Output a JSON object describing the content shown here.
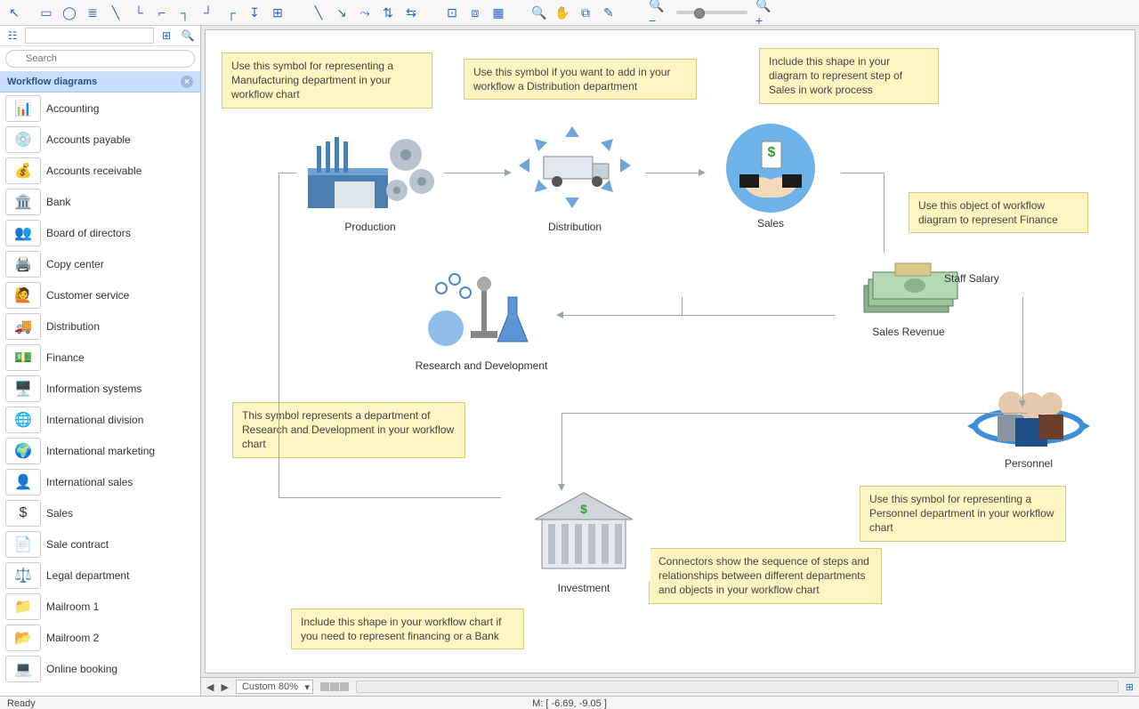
{
  "toolbar_icons": [
    "↖",
    "▭",
    "◯",
    "≣",
    "⤡",
    "↳",
    "⌐",
    "⎍",
    "└",
    "┌",
    "↧",
    "⊞",
    " ",
    "╲",
    "↘",
    "⤳",
    "⇅",
    "⇆",
    " ",
    "⊡",
    "⧈",
    "▦",
    " ",
    "⊕",
    "✋",
    "≡",
    "✎",
    " ",
    "🔍-",
    "",
    "🔍+"
  ],
  "search": {
    "placeholder": "Search"
  },
  "section_title": "Workflow diagrams",
  "stencils": [
    {
      "label": "Accounting",
      "glyph": "📊"
    },
    {
      "label": "Accounts payable",
      "glyph": "💿"
    },
    {
      "label": "Accounts receivable",
      "glyph": "💰"
    },
    {
      "label": "Bank",
      "glyph": "🏛️"
    },
    {
      "label": "Board of directors",
      "glyph": "👥"
    },
    {
      "label": "Copy center",
      "glyph": "🖨️"
    },
    {
      "label": "Customer service",
      "glyph": "🙋"
    },
    {
      "label": "Distribution",
      "glyph": "🚚"
    },
    {
      "label": "Finance",
      "glyph": "💵"
    },
    {
      "label": "Information systems",
      "glyph": "🖥️"
    },
    {
      "label": "International division",
      "glyph": "🌐"
    },
    {
      "label": "International marketing",
      "glyph": "🌍"
    },
    {
      "label": "International sales",
      "glyph": "👤"
    },
    {
      "label": "Sales",
      "glyph": "$"
    },
    {
      "label": "Sale contract",
      "glyph": "📄"
    },
    {
      "label": "Legal department",
      "glyph": "⚖️"
    },
    {
      "label": "Mailroom 1",
      "glyph": "📁"
    },
    {
      "label": "Mailroom 2",
      "glyph": "📂"
    },
    {
      "label": "Online booking",
      "glyph": "💻"
    }
  ],
  "nodes": {
    "production": {
      "label": "Production"
    },
    "distribution": {
      "label": "Distribution"
    },
    "sales": {
      "label": "Sales"
    },
    "research": {
      "label": "Research and Development"
    },
    "sales_revenue": {
      "label": "Sales Revenue"
    },
    "staff_salary": {
      "label": "Staff Salary"
    },
    "investment": {
      "label": "Investment"
    },
    "personnel": {
      "label": "Personnel"
    }
  },
  "callouts": {
    "c1": "Use this symbol for representing a Manufacturing department in your workflow chart",
    "c2": "Use this symbol if you want to add in your workflow a Distribution department",
    "c3": "Include this shape in your diagram to represent step of Sales in work process",
    "c4": "Use this object of workflow diagram to represent Finance",
    "c5": "This symbol represents a department of Research and Development in your workflow chart",
    "c6": "Include this shape in your workflow chart if you need to represent financing or a Bank",
    "c7": "Connectors show the sequence of steps and relationships between different departments and objects in your workflow chart",
    "c8": "Use this symbol for representing a Personnel department in your workflow chart"
  },
  "status": {
    "zoom": "Custom 80%",
    "ready": "Ready",
    "mouse": "M: [ -6.69, -9.05 ]"
  }
}
